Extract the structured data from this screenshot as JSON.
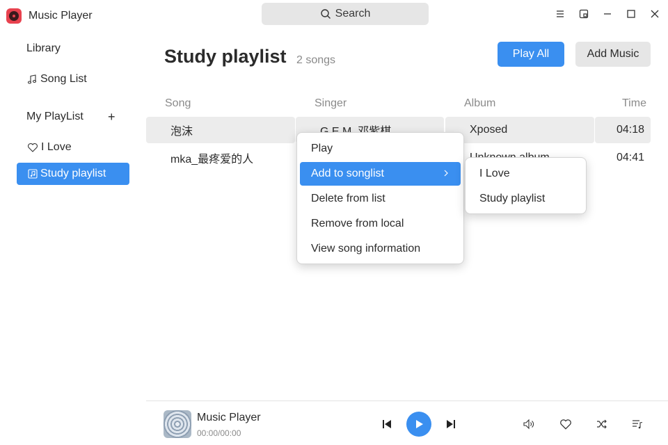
{
  "app": {
    "title": "Music Player"
  },
  "search": {
    "label": "Search"
  },
  "sidebar": {
    "library": "Library",
    "song_list": "Song List",
    "my_playlist": "My PlayList",
    "add_symbol": "+",
    "playlists": [
      {
        "label": "I Love",
        "icon": "heart-icon"
      },
      {
        "label": "Study playlist",
        "icon": "music-file-icon",
        "selected": true
      }
    ]
  },
  "main": {
    "title": "Study playlist",
    "song_count": "2 songs",
    "play_all": "Play All",
    "add_music": "Add Music",
    "columns": [
      "Song",
      "Singer",
      "Album",
      "Time"
    ],
    "songs": [
      {
        "song": "泡沫",
        "singer": "G.E.M. 邓紫棋",
        "album": "Xposed",
        "time": "04:18"
      },
      {
        "song": "mka_最疼爱的人",
        "singer": "",
        "album": "Unknown album",
        "time": "04:41"
      }
    ]
  },
  "context_menu": {
    "items": [
      "Play",
      "Add to songlist",
      "Delete from list",
      "Remove from local",
      "View song information"
    ],
    "active_index": 1,
    "submenu": [
      "I Love",
      "Study playlist"
    ]
  },
  "player": {
    "title": "Music Player",
    "time": "00:00/00:00"
  },
  "colors": {
    "accent": "#3a8ff0",
    "app_icon": "#e8424f",
    "row_highlight": "#ececec",
    "button_secondary": "#e6e6e6"
  }
}
